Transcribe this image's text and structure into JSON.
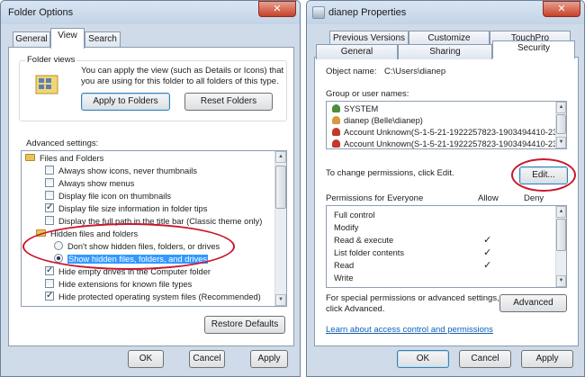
{
  "folder_options": {
    "title": "Folder Options",
    "close_glyph": "✕",
    "tabs": [
      "General",
      "View",
      "Search"
    ],
    "folder_views": {
      "group_title": "Folder views",
      "description_line1": "You can apply the view (such as Details or Icons) that",
      "description_line2": "you are using for this folder to all folders of this type.",
      "apply_button": "Apply to Folders",
      "reset_button": "Reset Folders"
    },
    "advanced_label": "Advanced settings:",
    "tree_items": [
      {
        "kind": "folder",
        "label": "Files and Folders"
      },
      {
        "kind": "checkbox",
        "checked": false,
        "label": "Always show icons, never thumbnails"
      },
      {
        "kind": "checkbox",
        "checked": false,
        "label": "Always show menus"
      },
      {
        "kind": "checkbox",
        "checked": false,
        "label": "Display file icon on thumbnails"
      },
      {
        "kind": "checkbox",
        "checked": true,
        "label": "Display file size information in folder tips"
      },
      {
        "kind": "checkbox",
        "checked": false,
        "label": "Display the full path in the title bar (Classic theme only)"
      },
      {
        "kind": "folder",
        "label": "Hidden files and folders"
      },
      {
        "kind": "radio",
        "checked": false,
        "label": "Don't show hidden files, folders, or drives"
      },
      {
        "kind": "radio",
        "checked": true,
        "selected": true,
        "label": "Show hidden files, folders, and drives"
      },
      {
        "kind": "checkbox",
        "checked": true,
        "label": "Hide empty drives in the Computer folder"
      },
      {
        "kind": "checkbox",
        "checked": false,
        "label": "Hide extensions for known file types"
      },
      {
        "kind": "checkbox",
        "checked": true,
        "label": "Hide protected operating system files (Recommended)"
      }
    ],
    "restore_button": "Restore Defaults",
    "ok_button": "OK",
    "cancel_button": "Cancel",
    "apply_button": "Apply"
  },
  "properties": {
    "title": "dianep Properties",
    "close_glyph": "✕",
    "tabs_back": [
      "Previous Versions",
      "Customize",
      "TouchPro"
    ],
    "tabs_front": [
      "General",
      "Sharing",
      "Security"
    ],
    "object_name_label": "Object name:",
    "object_name_value": "C:\\Users\\dianep",
    "group_label": "Group or user names:",
    "users": [
      {
        "name": "SYSTEM",
        "color": "#4c8c3a"
      },
      {
        "name": "dianep (Belle\\dianep)",
        "color": "#d89a3a"
      },
      {
        "name": "Account Unknown(S-1-5-21-1922257823-1903494410-230",
        "color": "#c0392b"
      },
      {
        "name": "Account Unknown(S-1-5-21-1922257823-1903494410-230",
        "color": "#c0392b"
      }
    ],
    "change_text": "To change permissions, click Edit.",
    "edit_button": "Edit...",
    "permissions_label": "Permissions for Everyone",
    "allow_header": "Allow",
    "deny_header": "Deny",
    "permissions": [
      {
        "name": "Full control",
        "allow": ""
      },
      {
        "name": "Modify",
        "allow": ""
      },
      {
        "name": "Read & execute",
        "allow": "✓"
      },
      {
        "name": "List folder contents",
        "allow": "✓"
      },
      {
        "name": "Read",
        "allow": "✓"
      },
      {
        "name": "Write",
        "allow": ""
      }
    ],
    "special_line1": "For special permissions or advanced settings,",
    "special_line2": "click Advanced.",
    "advanced_button": "Advanced",
    "learn_link": "Learn about access control and permissions",
    "ok_button": "OK",
    "cancel_button": "Cancel",
    "apply_button": "Apply"
  },
  "colors": {
    "highlight_oval": "#c8192e",
    "selection": "#3399ff",
    "link": "#0e5fb4"
  }
}
